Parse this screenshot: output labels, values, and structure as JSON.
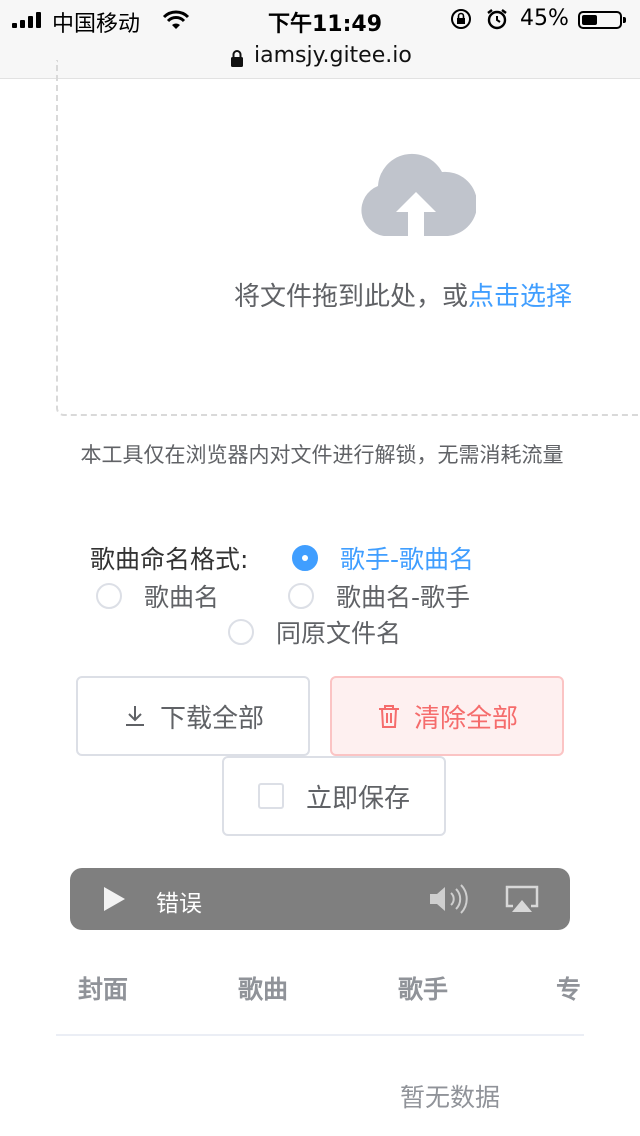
{
  "status_bar": {
    "carrier": "中国移动",
    "time": "下午11:49",
    "battery": "45%",
    "battery_level": 0.45
  },
  "browser": {
    "url": "iamsjy.gitee.io"
  },
  "upload": {
    "text": "将文件拖到此处，或",
    "link": "点击选择"
  },
  "tip": "本工具仅在浏览器内对文件进行解锁，无需消耗流量",
  "naming": {
    "label": "歌曲命名格式:",
    "options": [
      {
        "label": "歌手-歌曲名",
        "checked": true
      },
      {
        "label": "歌曲名",
        "checked": false
      },
      {
        "label": "歌曲名-歌手",
        "checked": false
      },
      {
        "label": "同原文件名",
        "checked": false
      }
    ]
  },
  "buttons": {
    "download_all": "下载全部",
    "clear_all": "清除全部",
    "save_now": "立即保存"
  },
  "audio": {
    "status": "错误"
  },
  "table": {
    "headers": [
      "封面",
      "歌曲",
      "歌手",
      "专"
    ],
    "empty": "暂无数据"
  },
  "colors": {
    "primary": "#409eff",
    "danger": "#f56c6c",
    "danger_bg": "#fef0f0"
  }
}
